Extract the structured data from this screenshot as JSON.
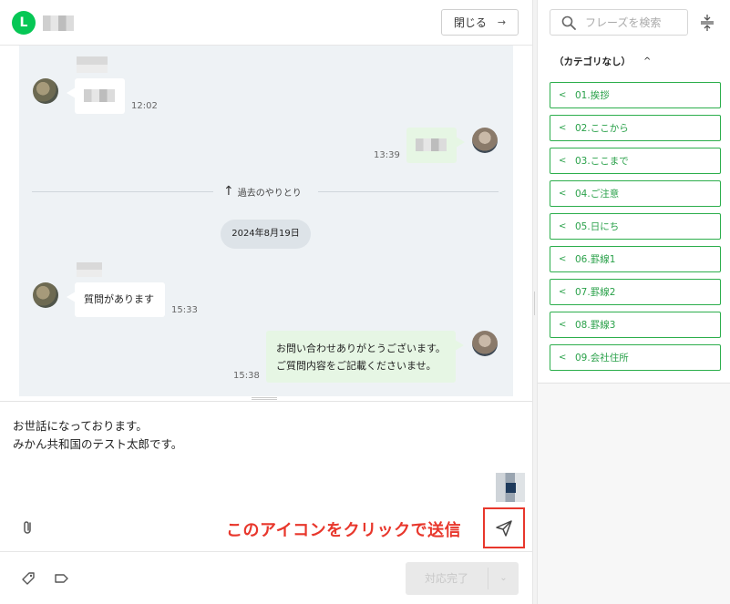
{
  "header": {
    "logo_letter": "L",
    "close_label": "閉じる",
    "close_arrow": "→"
  },
  "chat": {
    "messages": [
      {
        "side": "left",
        "text": "",
        "time": "12:02"
      },
      {
        "side": "right",
        "text": "",
        "time": "13:39"
      },
      {
        "side": "left",
        "text": "質問があります",
        "time": "15:33"
      },
      {
        "side": "right",
        "lines": [
          "お問い合わせありがとうございます。",
          "ご質問内容をご記載くださいませ。"
        ],
        "time": "15:38"
      }
    ],
    "past_label": "過去のやりとり",
    "date_chip": "2024年8月19日"
  },
  "composer": {
    "lines": [
      "お世話になっております。",
      "みかん共和国のテスト太郎です。"
    ],
    "callout": "このアイコンをクリックで送信",
    "done_label": "対応完了",
    "done_dropdown": "⌄"
  },
  "sidebar": {
    "search_placeholder": "フレーズを検索",
    "category": "（カテゴリなし）",
    "category_caret": "^",
    "phrases": [
      "01.挨拶",
      "02.ここから",
      "03.ここまで",
      "04.ご注意",
      "05.日にち",
      "06.罫線1",
      "07.罫線2",
      "08.罫線3",
      "09.会社住所"
    ]
  },
  "colors": {
    "line_green": "#06c755",
    "phrase_green": "#2aa14a",
    "callout_red": "#e8372c"
  }
}
